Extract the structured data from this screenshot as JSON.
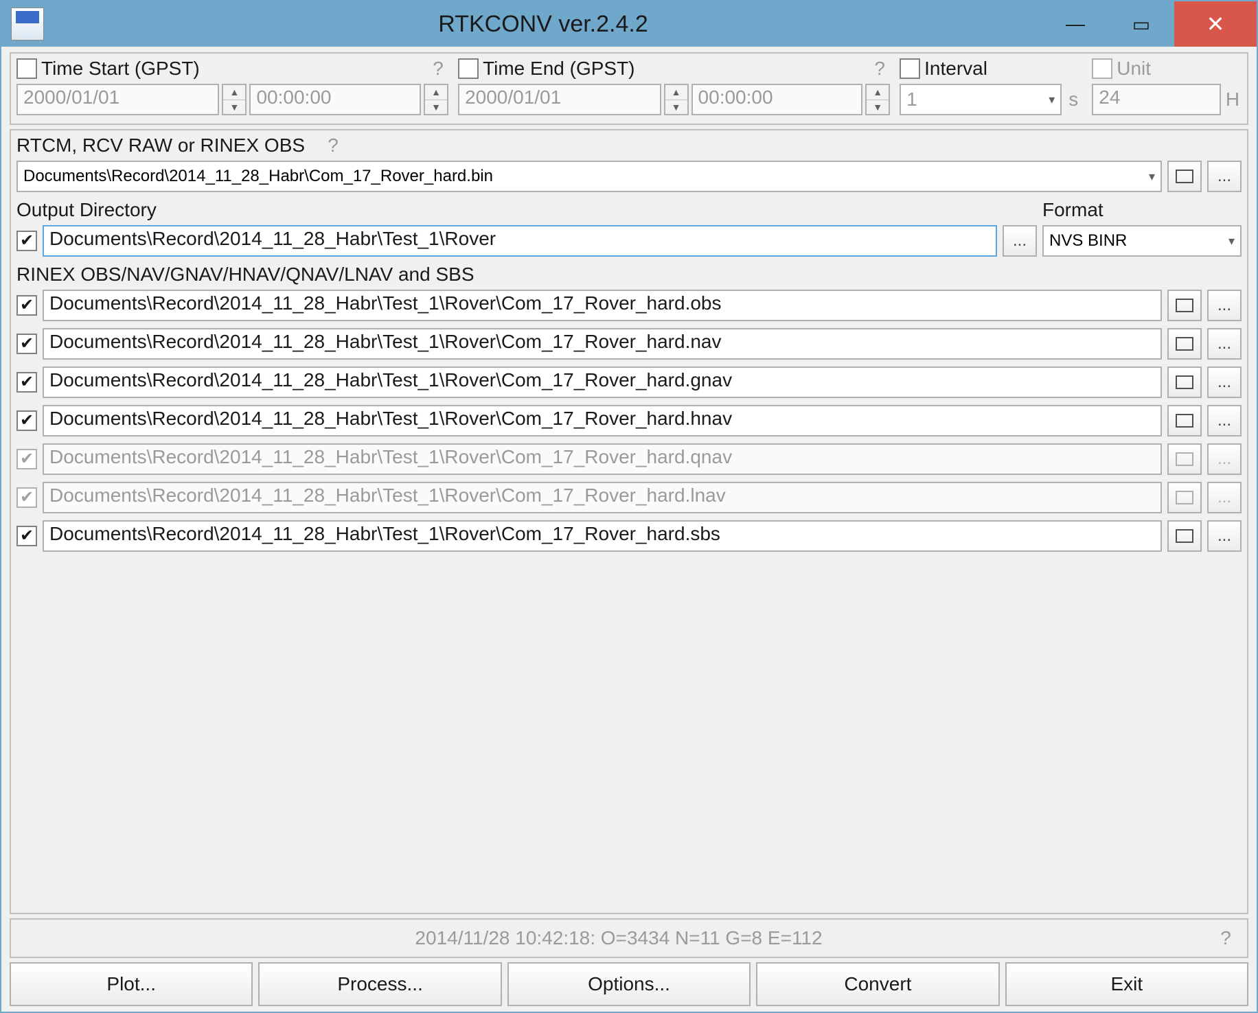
{
  "window": {
    "title": "RTKCONV ver.2.4.2"
  },
  "time": {
    "start_label": "Time Start (GPST)",
    "start_date": "2000/01/01",
    "start_time": "00:00:00",
    "end_label": "Time End (GPST)",
    "end_date": "2000/01/01",
    "end_time": "00:00:00",
    "interval_label": "Interval",
    "interval_value": "1",
    "interval_unit": "s",
    "unit_label": "Unit",
    "unit_value": "24",
    "unit_suffix": "H",
    "q": "?"
  },
  "input": {
    "label": "RTCM, RCV RAW or RINEX OBS",
    "q": "?",
    "path": "Documents\\Record\\2014_11_28_Habr\\Com_17_Rover_hard.bin"
  },
  "outdir": {
    "label": "Output Directory",
    "path": "Documents\\Record\\2014_11_28_Habr\\Test_1\\Rover",
    "format_label": "Format",
    "format_value": "NVS BINR"
  },
  "outputs": {
    "label": "RINEX OBS/NAV/GNAV/HNAV/QNAV/LNAV and SBS",
    "rows": [
      {
        "path": "Documents\\Record\\2014_11_28_Habr\\Test_1\\Rover\\Com_17_Rover_hard.obs",
        "enabled": true
      },
      {
        "path": "Documents\\Record\\2014_11_28_Habr\\Test_1\\Rover\\Com_17_Rover_hard.nav",
        "enabled": true
      },
      {
        "path": "Documents\\Record\\2014_11_28_Habr\\Test_1\\Rover\\Com_17_Rover_hard.gnav",
        "enabled": true
      },
      {
        "path": "Documents\\Record\\2014_11_28_Habr\\Test_1\\Rover\\Com_17_Rover_hard.hnav",
        "enabled": true
      },
      {
        "path": "Documents\\Record\\2014_11_28_Habr\\Test_1\\Rover\\Com_17_Rover_hard.qnav",
        "enabled": false
      },
      {
        "path": "Documents\\Record\\2014_11_28_Habr\\Test_1\\Rover\\Com_17_Rover_hard.lnav",
        "enabled": false
      },
      {
        "path": "Documents\\Record\\2014_11_28_Habr\\Test_1\\Rover\\Com_17_Rover_hard.sbs",
        "enabled": true
      }
    ]
  },
  "status": {
    "text": "2014/11/28 10:42:18: O=3434 N=11 G=8 E=112",
    "q": "?"
  },
  "buttons": {
    "plot": "Plot...",
    "process": "Process...",
    "options": "Options...",
    "convert": "Convert",
    "exit": "Exit"
  },
  "dots": "..."
}
